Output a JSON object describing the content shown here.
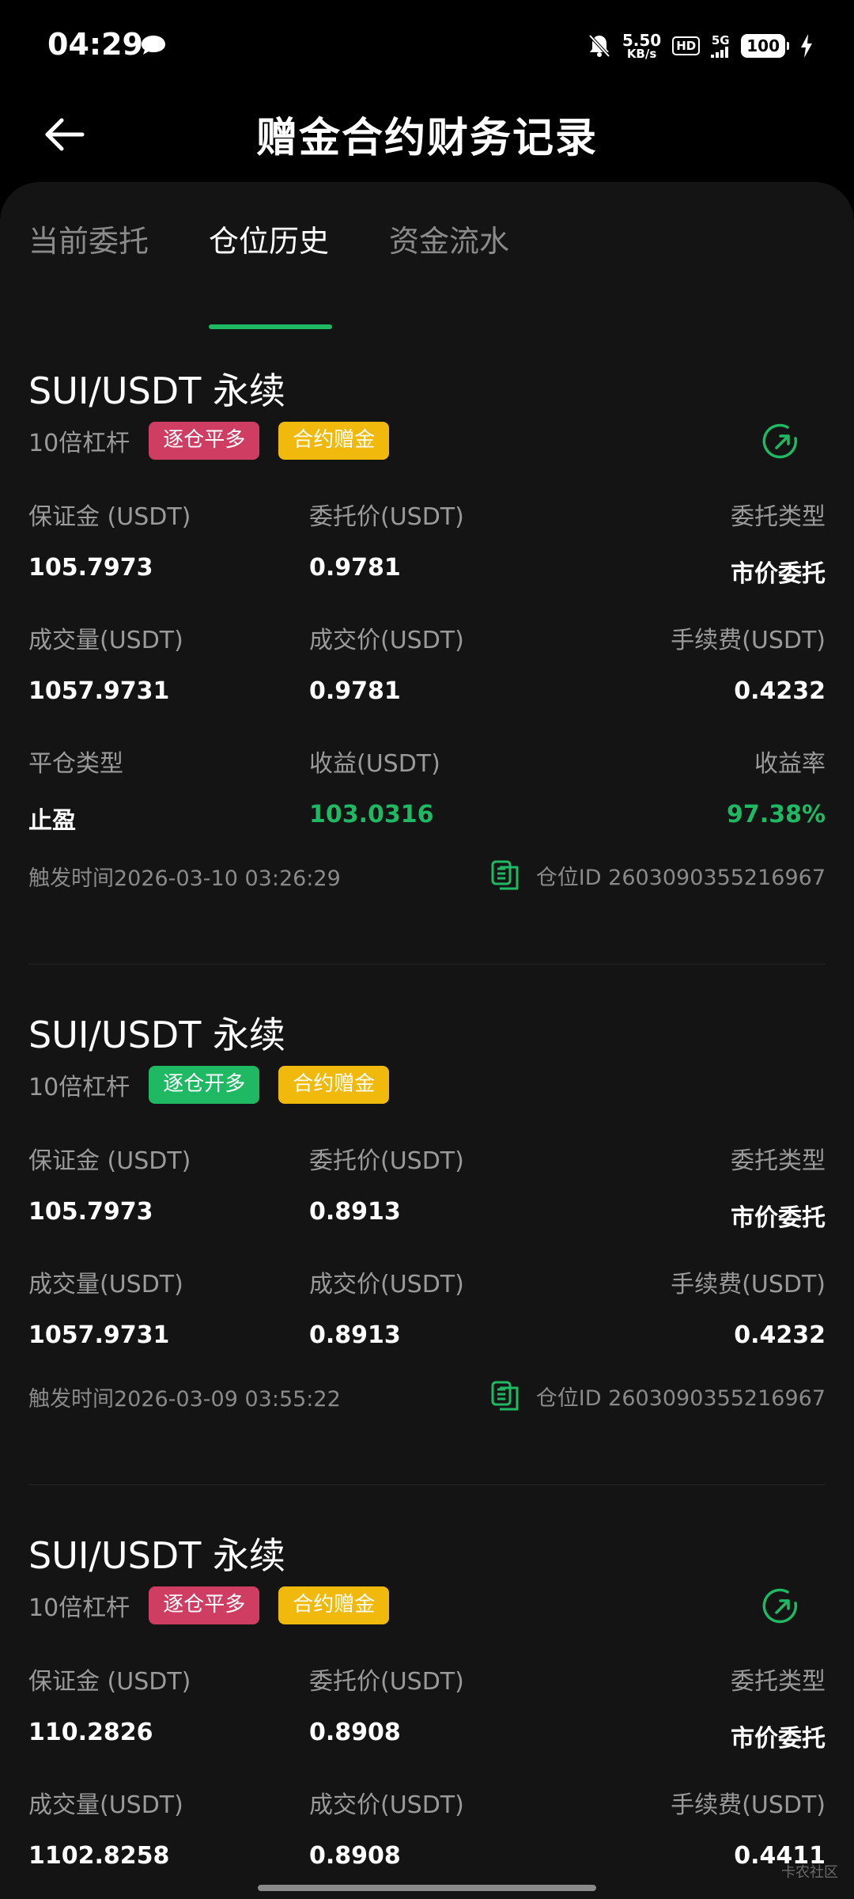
{
  "status_bar": {
    "time": "04:29",
    "net_speed_value": "5.50",
    "net_speed_unit": "KB/s",
    "hd": "HD",
    "signal": "5G",
    "battery": "100",
    "icons": [
      "message-icon",
      "mute-icon",
      "hd-icon",
      "signal-5g-icon",
      "battery-icon",
      "charging-icon"
    ]
  },
  "header": {
    "title": "赠金合约财务记录"
  },
  "tabs": [
    {
      "label": "当前委托",
      "active": false
    },
    {
      "label": "仓位历史",
      "active": true
    },
    {
      "label": "资金流水",
      "active": false
    }
  ],
  "colors": {
    "accent_green": "#1fb964",
    "tag_red": "#cf3d62",
    "tag_yellow": "#f0b90b",
    "bg": "#141414"
  },
  "cards": [
    {
      "title": "SUI/USDT 永续",
      "leverage": "10倍杠杆",
      "tags": [
        {
          "text": "逐仓平多",
          "color": "red"
        },
        {
          "text": "合约赠金",
          "color": "yellow"
        }
      ],
      "fields": [
        {
          "label": "保证金 (USDT)",
          "value": "105.7973"
        },
        {
          "label": "委托价(USDT)",
          "value": "0.9781"
        },
        {
          "label": "委托类型",
          "value": "市价委托"
        },
        {
          "label": "成交量(USDT)",
          "value": "1057.9731"
        },
        {
          "label": "成交价(USDT)",
          "value": "0.9781"
        },
        {
          "label": "手续费(USDT)",
          "value": "0.4232"
        },
        {
          "label": "平仓类型",
          "value": "止盈"
        },
        {
          "label": "收益(USDT)",
          "value": "103.0316"
        },
        {
          "label": "收益率",
          "value": "97.38%"
        }
      ],
      "trigger_time": "触发时间2026-03-10 03:26:29",
      "position_id": "仓位ID 2603090355216967"
    },
    {
      "title": "SUI/USDT 永续",
      "leverage": "10倍杠杆",
      "tags": [
        {
          "text": "逐仓开多",
          "color": "green"
        },
        {
          "text": "合约赠金",
          "color": "yellow"
        }
      ],
      "fields": [
        {
          "label": "保证金 (USDT)",
          "value": "105.7973"
        },
        {
          "label": "委托价(USDT)",
          "value": "0.8913"
        },
        {
          "label": "委托类型",
          "value": "市价委托"
        },
        {
          "label": "成交量(USDT)",
          "value": "1057.9731"
        },
        {
          "label": "成交价(USDT)",
          "value": "0.8913"
        },
        {
          "label": "手续费(USDT)",
          "value": "0.4232"
        }
      ],
      "trigger_time": "触发时间2026-03-09 03:55:22",
      "position_id": "仓位ID 2603090355216967"
    },
    {
      "title": "SUI/USDT 永续",
      "leverage": "10倍杠杆",
      "tags": [
        {
          "text": "逐仓平多",
          "color": "red"
        },
        {
          "text": "合约赠金",
          "color": "yellow"
        }
      ],
      "fields": [
        {
          "label": "保证金 (USDT)",
          "value": "110.2826"
        },
        {
          "label": "委托价(USDT)",
          "value": "0.8908"
        },
        {
          "label": "委托类型",
          "value": "市价委托"
        },
        {
          "label": "成交量(USDT)",
          "value": "1102.8258"
        },
        {
          "label": "成交价(USDT)",
          "value": "0.8908"
        },
        {
          "label": "手续费(USDT)",
          "value": "0.4411"
        }
      ]
    }
  ],
  "watermark": "卡农社区"
}
